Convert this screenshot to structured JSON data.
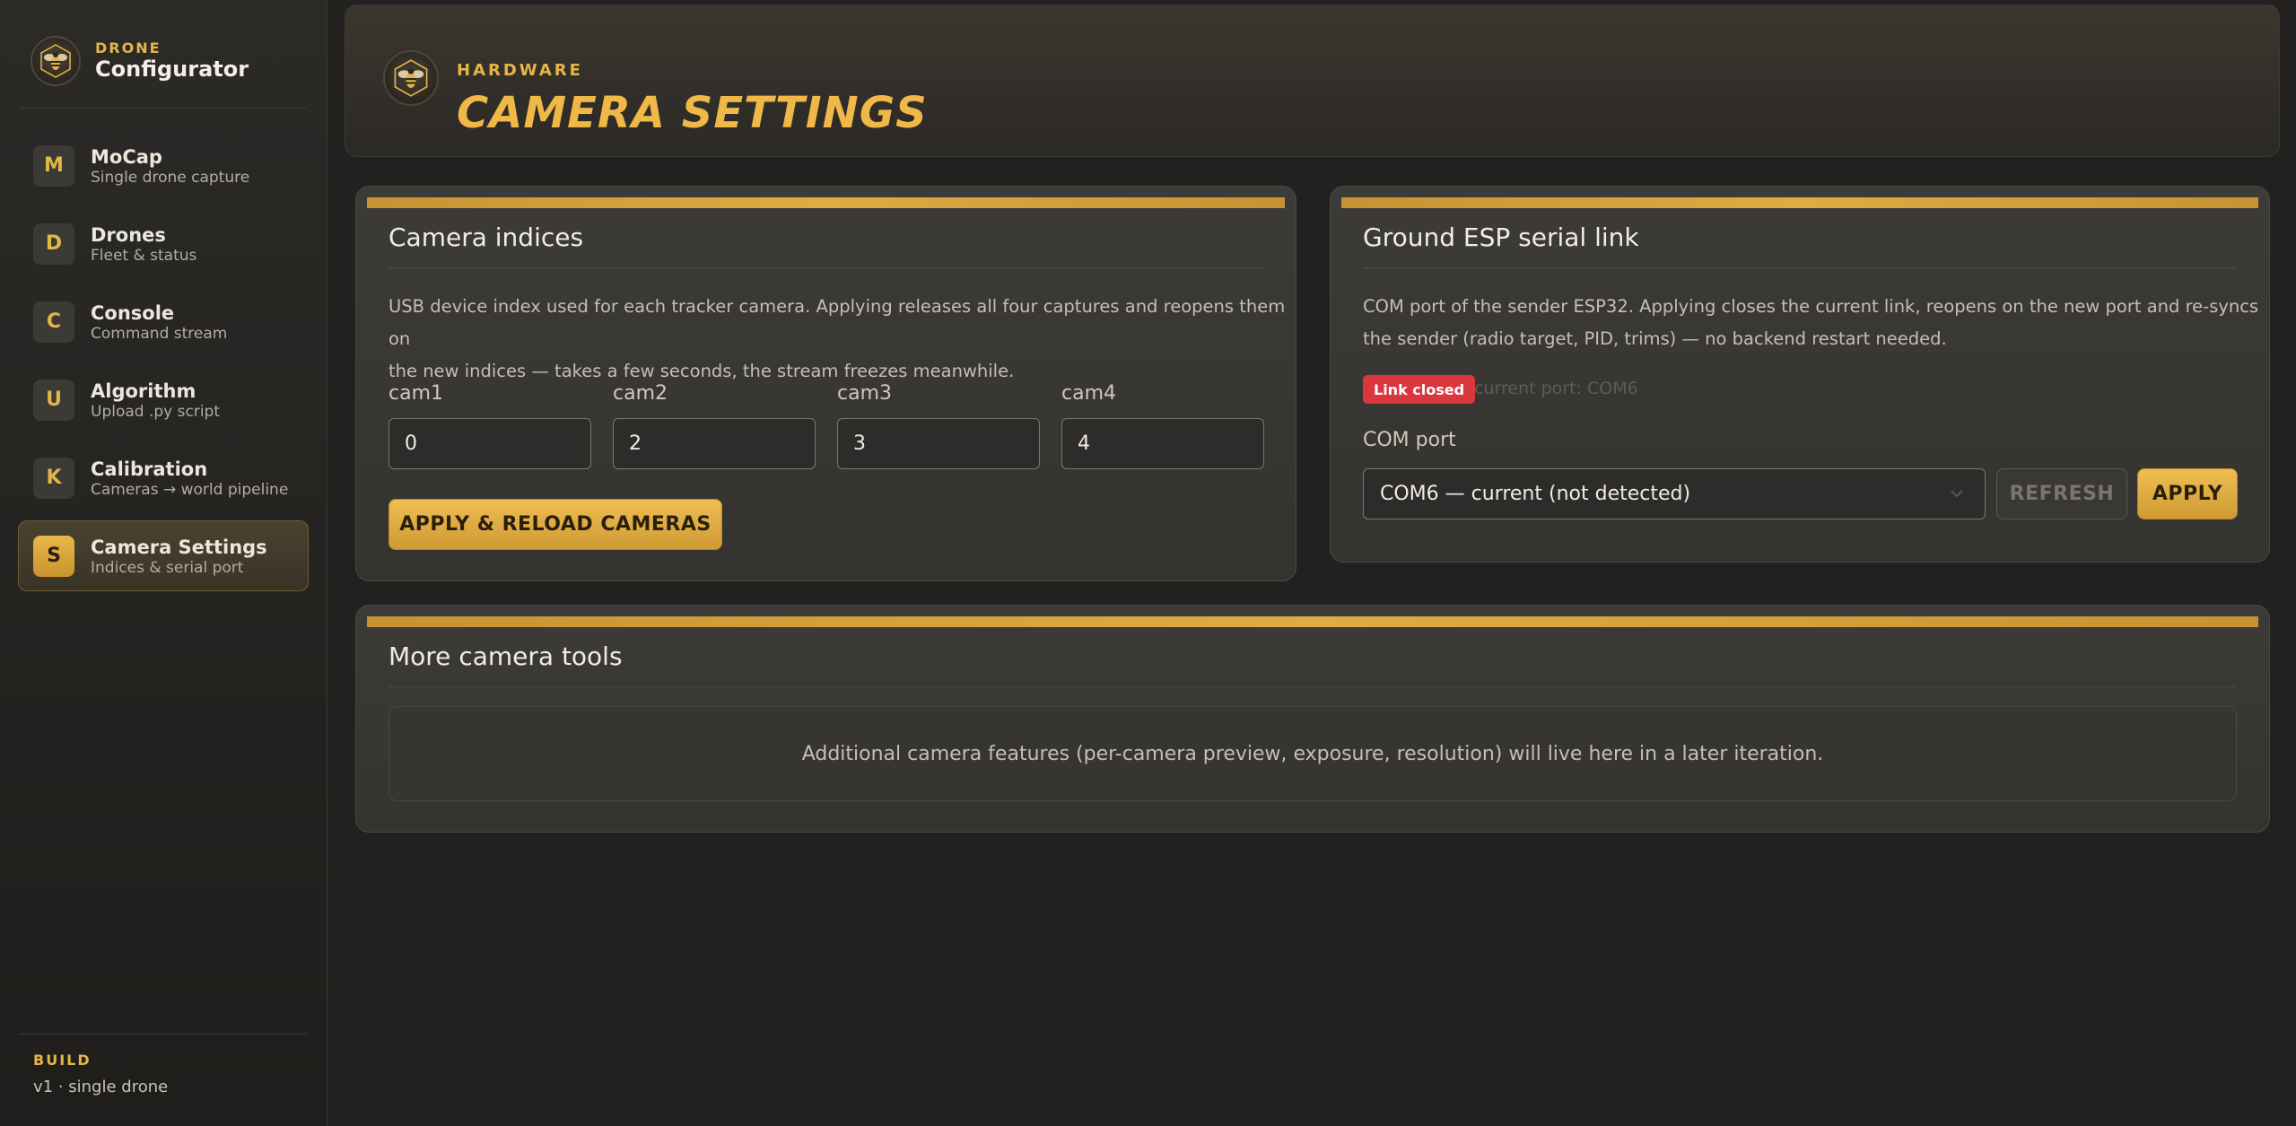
{
  "brand": {
    "kicker": "DRONE",
    "title": "Configurator",
    "logo_icon": "bee-icon"
  },
  "nav": {
    "items": [
      {
        "badge": "M",
        "label": "MoCap",
        "sub": "Single drone capture",
        "active": false
      },
      {
        "badge": "D",
        "label": "Drones",
        "sub": "Fleet & status",
        "active": false
      },
      {
        "badge": "C",
        "label": "Console",
        "sub": "Command stream",
        "active": false
      },
      {
        "badge": "U",
        "label": "Algorithm",
        "sub": "Upload .py script",
        "active": false
      },
      {
        "badge": "K",
        "label": "Calibration",
        "sub": "Cameras → world pipeline",
        "active": false
      },
      {
        "badge": "S",
        "label": "Camera Settings",
        "sub": "Indices & serial port",
        "active": true
      }
    ]
  },
  "build": {
    "label": "BUILD",
    "value": "v1 · single drone"
  },
  "header": {
    "kicker": "HARDWARE",
    "title": "CAMERA SETTINGS"
  },
  "camera_indices": {
    "title": "Camera indices",
    "description_line1": "USB device index used for each tracker camera. Applying releases all four captures and reopens them on",
    "description_line2": "the new indices — takes a few seconds, the stream freezes meanwhile.",
    "cams": [
      {
        "label": "cam1",
        "value": "0"
      },
      {
        "label": "cam2",
        "value": "2"
      },
      {
        "label": "cam3",
        "value": "3"
      },
      {
        "label": "cam4",
        "value": "4"
      }
    ],
    "apply_label": "APPLY & RELOAD CAMERAS"
  },
  "serial_link": {
    "title": "Ground ESP serial link",
    "description_line1": "COM port of the sender ESP32. Applying closes the current link, reopens on the new port and re-syncs",
    "description_line2": "the sender (radio target, PID, trims) — no backend restart needed.",
    "status": "Link closed",
    "current_port": "current port: COM6",
    "com_label": "COM port",
    "com_selected": "COM6 — current (not detected)",
    "refresh_label": "REFRESH",
    "apply_label": "APPLY"
  },
  "tools": {
    "title": "More camera tools",
    "message": "Additional camera features (per-camera preview, exposure, resolution) will live here in a later iteration."
  },
  "colors": {
    "accent": "#e4b548",
    "status_closed": "#d9363e"
  }
}
